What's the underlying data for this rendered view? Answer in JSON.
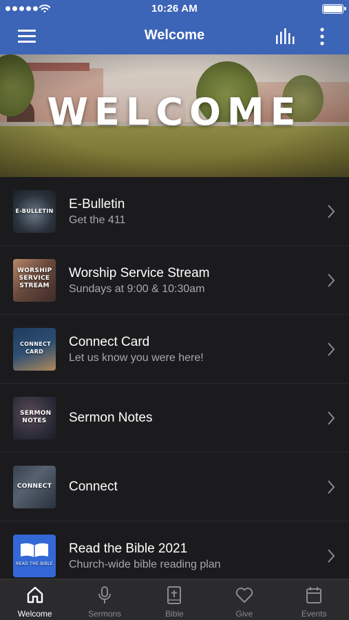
{
  "status_bar": {
    "time": "10:26 AM"
  },
  "nav": {
    "title": "Welcome"
  },
  "banner": {
    "title": "WELCOME"
  },
  "list": [
    {
      "title": "E-Bulletin",
      "subtitle": "Get the 411",
      "thumb_text": "E-BULLETIN",
      "icon": "chevron-right-icon"
    },
    {
      "title": "Worship Service Stream",
      "subtitle": "Sundays at 9:00 & 10:30am",
      "thumb_text": "WORSHIP SERVICE STREAM",
      "icon": "chevron-right-icon"
    },
    {
      "title": "Connect Card",
      "subtitle": "Let us know you were here!",
      "thumb_text": "CONNECT CARD",
      "icon": "chevron-right-icon"
    },
    {
      "title": "Sermon Notes",
      "subtitle": "",
      "thumb_text": "SERMON NOTES",
      "icon": "chevron-right-icon"
    },
    {
      "title": "Connect",
      "subtitle": "",
      "thumb_text": "CONNECT",
      "icon": "chevron-right-icon"
    },
    {
      "title": "Read the Bible 2021",
      "subtitle": "Church-wide bible reading plan",
      "thumb_text": "READ THE BIBLE",
      "icon": "chevron-right-icon"
    }
  ],
  "tabs": [
    {
      "label": "Welcome",
      "icon": "home-icon",
      "active": true
    },
    {
      "label": "Sermons",
      "icon": "microphone-icon",
      "active": false
    },
    {
      "label": "Bible",
      "icon": "bible-icon",
      "active": false
    },
    {
      "label": "Give",
      "icon": "heart-icon",
      "active": false
    },
    {
      "label": "Events",
      "icon": "calendar-icon",
      "active": false
    }
  ],
  "colors": {
    "nav_bg": "#3c64b7",
    "list_bg": "#1b1b1d",
    "tab_bg": "#2b2b2e",
    "subtitle": "#a9a9ad",
    "tab_inactive": "#8b8b90"
  }
}
